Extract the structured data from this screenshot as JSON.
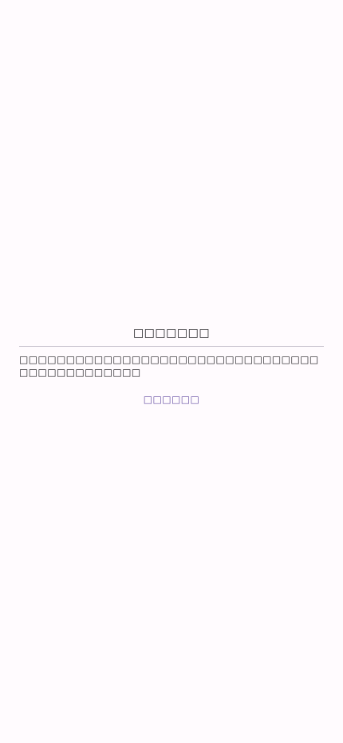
{
  "dialog": {
    "title": "□□□□□□□",
    "message": "□□□□□□□□□□□□□□□□□□□□□□□□□□□□□□□□□□□□□□□□□□□□□",
    "action_label": "□□□□□□"
  },
  "colors": {
    "background": "#fffbfe",
    "text": "#1c1b1f",
    "divider": "#cac4d0",
    "accent": "#6750a4"
  }
}
